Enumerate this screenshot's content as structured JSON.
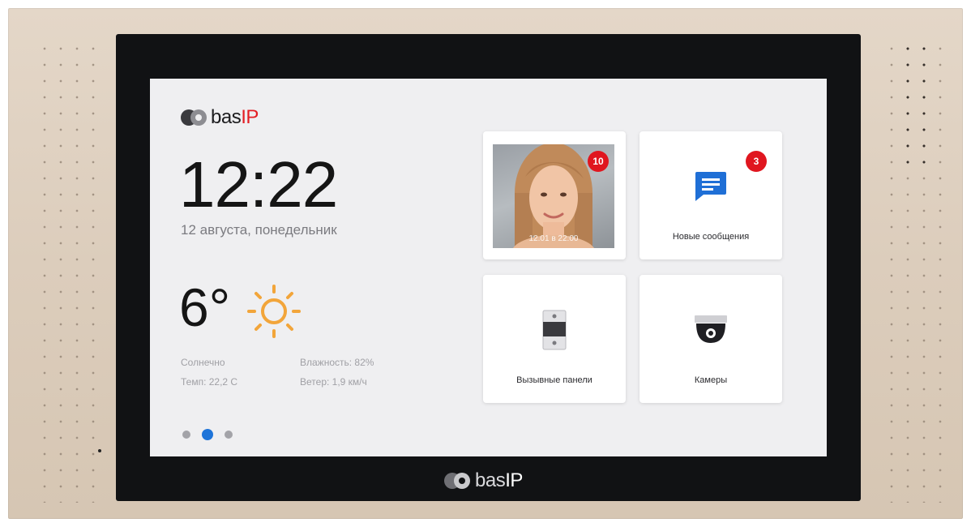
{
  "device": {
    "bezel_logo": {
      "brand": "bas",
      "suffix": "IP"
    }
  },
  "screen": {
    "logo": {
      "brand": "bas",
      "suffix": "IP"
    },
    "clock": {
      "time": "12:22",
      "date": "12 августа, понедельник"
    },
    "weather": {
      "temperature": "6°",
      "condition_icon": "sun-icon",
      "condition": "Солнечно",
      "feels_like": "Темп: 22,2 С",
      "humidity": "Влажность: 82%",
      "wind": "Ветер: 1,9 км/ч"
    },
    "pagination": {
      "total": 3,
      "active_index": 1
    },
    "tiles": {
      "missed_calls": {
        "badge": "10",
        "timestamp": "12.01 в 22:00"
      },
      "messages": {
        "label": "Новые сообщения",
        "badge": "3",
        "icon": "chat-message-icon"
      },
      "call_panels": {
        "label": "Вызывные панели",
        "icon": "call-panel-icon"
      },
      "cameras": {
        "label": "Камеры",
        "icon": "dome-camera-icon"
      }
    }
  },
  "colors": {
    "accent_blue": "#1e74d9",
    "badge_red": "#e0161f",
    "brand_red": "#e31e24",
    "sun_orange": "#f2a53a",
    "housing": "#dccdbc",
    "bezel": "#111214",
    "screen_bg": "#efeff1"
  }
}
